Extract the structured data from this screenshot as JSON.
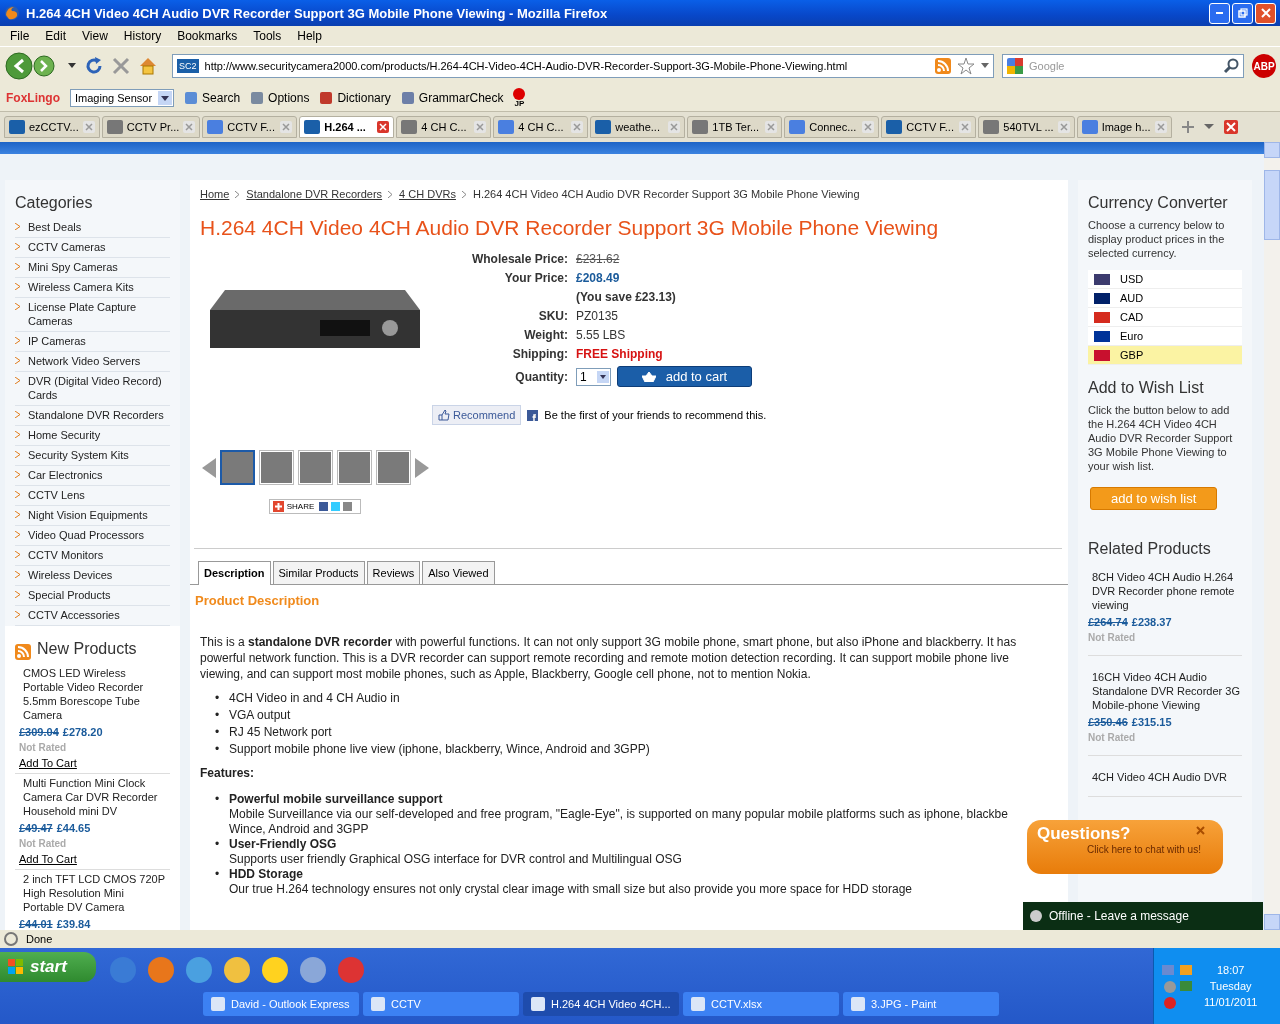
{
  "window": {
    "title": "H.264 4CH Video 4CH Audio DVR Recorder Support 3G Mobile Phone Viewing - Mozilla Firefox"
  },
  "menu": [
    "File",
    "Edit",
    "View",
    "History",
    "Bookmarks",
    "Tools",
    "Help"
  ],
  "nav": {
    "site_badge": "SC2",
    "url": "http://www.securitycamera2000.com/products/H.264-4CH-Video-4CH-Audio-DVR-Recorder-Support-3G-Mobile-Phone-Viewing.html",
    "search_placeholder": "Google",
    "adblock": "ABP"
  },
  "addon_bar": {
    "brand": "FoxLingo",
    "dropdown": "Imaging Sensor",
    "items": [
      "Search",
      "Options",
      "Dictionary",
      "GrammarCheck"
    ],
    "flag_label": "JP"
  },
  "tabs": [
    {
      "label": "ezCCTV...",
      "selected": false
    },
    {
      "label": "CCTV Pr...",
      "selected": false
    },
    {
      "label": "CCTV F...",
      "selected": false
    },
    {
      "label": "H.264 ...",
      "selected": true
    },
    {
      "label": "4 CH C...",
      "selected": false
    },
    {
      "label": "4 CH C...",
      "selected": false
    },
    {
      "label": "weathe...",
      "selected": false
    },
    {
      "label": "1TB Ter...",
      "selected": false
    },
    {
      "label": "Connec...",
      "selected": false
    },
    {
      "label": "CCTV F...",
      "selected": false
    },
    {
      "label": "540TVL ...",
      "selected": false
    },
    {
      "label": "Image h...",
      "selected": false
    }
  ],
  "page": {
    "breadcrumb": [
      "Home",
      "Standalone DVR Recorders",
      "4 CH DVRs",
      "H.264 4CH Video 4CH Audio DVR Recorder Support 3G Mobile Phone Viewing"
    ],
    "title": "H.264 4CH Video 4CH Audio DVR Recorder Support 3G Mobile Phone Viewing",
    "categories": {
      "title": "Categories",
      "items": [
        "Best Deals",
        "CCTV Cameras",
        "Mini Spy Cameras",
        "Wireless Camera Kits",
        "License Plate Capture Cameras",
        "IP Cameras",
        "Network Video Servers",
        "DVR (Digital Video Record) Cards",
        "Standalone DVR Recorders",
        "Home Security",
        "Security System Kits",
        "Car Electronics",
        "CCTV Lens",
        "Night Vision Equipments",
        "Video Quad Processors",
        "CCTV Monitors",
        "Wireless Devices",
        "Special Products",
        "CCTV Accessories"
      ]
    },
    "new_products": {
      "title": "New Products",
      "items": [
        {
          "name": "CMOS LED Wireless Portable Video Recorder 5.5mm Borescope Tube Camera",
          "old_price": "£309.04",
          "price": "£278.20",
          "rating": "Not Rated",
          "action": "Add To Cart"
        },
        {
          "name": "Multi Function Mini Clock Camera Car DVR Recorder Household mini DV",
          "old_price": "£49.47",
          "price": "£44.65",
          "rating": "Not Rated",
          "action": "Add To Cart"
        },
        {
          "name": "2 inch TFT LCD CMOS 720P High Resolution Mini Portable DV Camera",
          "old_price": "£44.01",
          "price": "£39.84"
        }
      ]
    },
    "details": [
      {
        "label": "Wholesale Price:",
        "value": "£231.62",
        "kind": "old"
      },
      {
        "label": "Your Price:",
        "value": "£208.49",
        "kind": "price"
      },
      {
        "value": "(You save £23.13)",
        "kind": "note"
      },
      {
        "label": "SKU:",
        "value": "PZ0135",
        "kind": "plain"
      },
      {
        "label": "Weight:",
        "value": "5.55 LBS",
        "kind": "plain"
      },
      {
        "label": "Shipping:",
        "value": "FREE Shipping",
        "kind": "alert"
      }
    ],
    "quantity": {
      "label": "Quantity:",
      "value": "1"
    },
    "add_to_cart": "add to cart",
    "recommend": "Recommend",
    "fb_text": "Be the first of your friends to recommend this.",
    "thumbnails": [
      {
        "selected": true
      },
      {
        "selected": false
      },
      {
        "selected": false
      },
      {
        "selected": false
      },
      {
        "selected": false
      }
    ],
    "share": "SHARE",
    "content_tabs": [
      {
        "label": "Description",
        "selected": true
      },
      {
        "label": "Similar Products",
        "selected": false
      },
      {
        "label": "Reviews",
        "selected": false
      },
      {
        "label": "Also Viewed",
        "selected": false
      }
    ],
    "description": {
      "heading": "Product Description",
      "intro": "This is a **standalone DVR recorder** with powerful functions. It can not only support 3G mobile phone, smart phone, but also iPhone and blackberry. It has powerful network function. This is a DVR recorder can support remote recording and remote motion detection recording. It can support mobile phone live viewing, and can support most mobile phones, such as Apple, Blackberry, Google cell phone, not to mention Nokia.",
      "bullets": [
        "4CH Video in and 4 CH Audio in",
        "VGA output",
        "RJ 45 Network port",
        "Support mobile phone live view (iphone, blackberry, Wince, Android and 3GPP)"
      ],
      "marker": "•",
      "features_title": "Features:",
      "features": [
        {
          "title": "Powerful mobile surveillance support",
          "lines": [
            "Mobile Surveillance via our self-developed and free program, \"Eagle-Eye\", is supported on many popular mobile platforms such as iphone, blackbe",
            "Wince, Android and 3GPP"
          ]
        },
        {
          "title": "User-Friendly OSG",
          "lines": [
            "Supports user friendly Graphical OSG interface for DVR control and Multilingual OSG"
          ]
        },
        {
          "title": "HDD Storage",
          "lines": [
            "Our true H.264 technology ensures not only crystal clear image with small size but also provide you more space for HDD storage"
          ]
        }
      ]
    },
    "currency": {
      "title": "Currency Converter",
      "text": "Choose a currency below to display product prices in the selected currency.",
      "options": [
        {
          "code": "USD",
          "selected": false,
          "color": "#3c3b6e"
        },
        {
          "code": "AUD",
          "selected": false,
          "color": "#012169"
        },
        {
          "code": "CAD",
          "selected": false,
          "color": "#d52b1e"
        },
        {
          "code": "Euro",
          "selected": false,
          "color": "#003399"
        },
        {
          "code": "GBP",
          "selected": true,
          "color": "#c8102e"
        }
      ]
    },
    "wishlist": {
      "title": "Add to Wish List",
      "text": "Click the button below to add the H.264 4CH Video 4CH Audio DVR Recorder Support 3G Mobile Phone Viewing to your wish list.",
      "button": "add to wish list"
    },
    "related": {
      "title": "Related Products",
      "items": [
        {
          "name": "8CH Video 4CH Audio H.264 DVR Recorder phone remote viewing",
          "old_price": "£264.74",
          "price": "£238.37",
          "rating": "Not Rated"
        },
        {
          "name": "16CH Video 4CH Audio Standalone DVR Recorder 3G Mobile-phone Viewing",
          "old_price": "£350.46",
          "price": "£315.15",
          "rating": "Not Rated"
        },
        {
          "name": "4CH Video 4CH Audio DVR"
        }
      ]
    },
    "chat": {
      "title": "Questions?",
      "text": "Click here to chat with us!",
      "offline": "Offline - Leave a message"
    }
  },
  "status": "Done",
  "taskbar": {
    "start": "start",
    "tasks": [
      {
        "label": "David - Outlook Express",
        "selected": false
      },
      {
        "label": "CCTV",
        "selected": false
      },
      {
        "label": "H.264 4CH Video 4CH...",
        "selected": true
      },
      {
        "label": "CCTV.xlsx",
        "selected": false
      },
      {
        "label": "3.JPG - Paint",
        "selected": false
      }
    ],
    "clock": {
      "time": "18:07",
      "day": "Tuesday",
      "date": "11/01/2011"
    }
  }
}
